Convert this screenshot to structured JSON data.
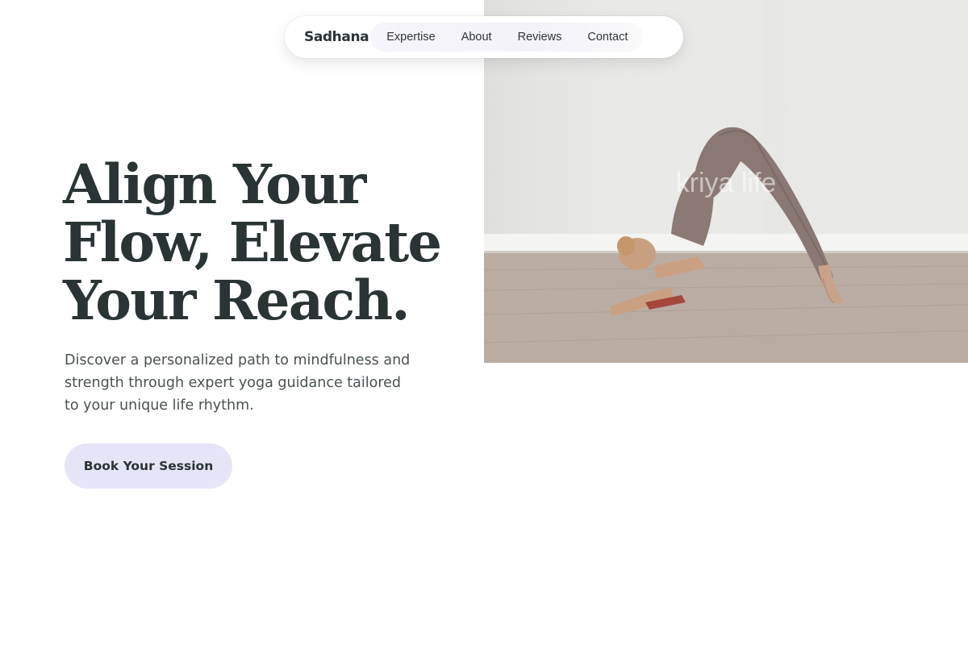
{
  "nav": {
    "brand": "Sadhana",
    "links": [
      "Expertise",
      "About",
      "Reviews",
      "Contact"
    ]
  },
  "hero": {
    "headline_lines": [
      "Align Your",
      "Flow, Elevate",
      "Your Reach."
    ],
    "lead": "Discover a personalized path to mindfulness and strength through expert yoga guidance tailored to your unique life rhythm.",
    "cta_label": "Book Your Session",
    "image_watermark": "kriya life"
  },
  "colors": {
    "text": "#2a3435",
    "body_text": "#4a5152",
    "cta_bg": "#e6e5f8",
    "nav_bg": "#ffffff"
  }
}
